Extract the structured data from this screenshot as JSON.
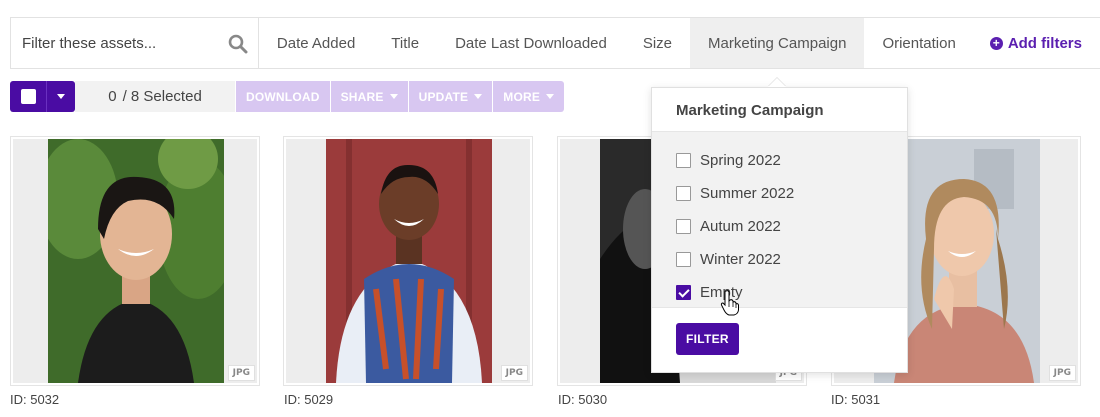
{
  "search": {
    "placeholder": "Filter these assets..."
  },
  "filter_tabs": [
    {
      "label": "Date Added"
    },
    {
      "label": "Title"
    },
    {
      "label": "Date Last Downloaded"
    },
    {
      "label": "Size"
    },
    {
      "label": "Marketing Campaign",
      "active": true
    },
    {
      "label": "Orientation"
    }
  ],
  "add_filters": {
    "label": "Add filters"
  },
  "toolbar": {
    "selected_count": "0",
    "selected_total": "/ 8 Selected",
    "actions": [
      {
        "label": "DOWNLOAD",
        "has_caret": false
      },
      {
        "label": "SHARE",
        "has_caret": true
      },
      {
        "label": "UPDATE",
        "has_caret": true
      },
      {
        "label": "MORE",
        "has_caret": true
      }
    ]
  },
  "assets": [
    {
      "id_label": "ID: 5032",
      "type": "JPG"
    },
    {
      "id_label": "ID: 5029",
      "type": "JPG"
    },
    {
      "id_label": "ID: 5030",
      "type": "JPG"
    },
    {
      "id_label": "ID: 5031",
      "type": "JPG"
    }
  ],
  "dropdown": {
    "title": "Marketing Campaign",
    "options": [
      {
        "label": "Spring 2022",
        "checked": false
      },
      {
        "label": "Summer 2022",
        "checked": false
      },
      {
        "label": "Autum 2022",
        "checked": false
      },
      {
        "label": "Winter 2022",
        "checked": false
      },
      {
        "label": "Empty",
        "checked": true
      }
    ],
    "filter_button": "FILTER"
  },
  "colors": {
    "accent": "#4a0ca3",
    "accent_light": "#d8c7f1",
    "link": "#5b1fb0"
  },
  "icons": {
    "search": "search-icon",
    "add": "plus-circle-icon",
    "cursor": "hand-pointer-icon"
  }
}
